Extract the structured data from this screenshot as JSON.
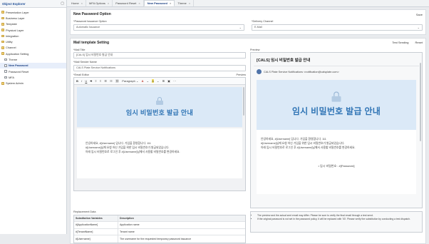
{
  "explorer": {
    "title": "Object Explorer",
    "items": [
      {
        "label": "Presentation Layer",
        "child": false,
        "selected": false
      },
      {
        "label": "Business Layer",
        "child": false,
        "selected": false
      },
      {
        "label": "Template",
        "child": false,
        "selected": false
      },
      {
        "label": "Physical Layer",
        "child": false,
        "selected": false
      },
      {
        "label": "Integration",
        "child": false,
        "selected": false
      },
      {
        "label": "Utility",
        "child": false,
        "selected": false
      },
      {
        "label": "Channel",
        "child": false,
        "selected": false
      },
      {
        "label": "Application Setting",
        "child": false,
        "selected": false
      },
      {
        "label": "Theme",
        "child": true,
        "selected": false
      },
      {
        "label": "New Password",
        "child": true,
        "selected": true
      },
      {
        "label": "Password Reset",
        "child": true,
        "selected": false
      },
      {
        "label": "MFA",
        "child": true,
        "selected": false
      },
      {
        "label": "System Admin",
        "child": false,
        "selected": false
      }
    ]
  },
  "tabs": [
    {
      "label": "Home",
      "active": false
    },
    {
      "label": "MFA Options",
      "active": false
    },
    {
      "label": "Password Reset",
      "active": false
    },
    {
      "label": "New Password",
      "active": true
    },
    {
      "label": "Theme",
      "active": false
    }
  ],
  "options": {
    "title": "New Password Option",
    "save_label": "Save",
    "issuance_label": "*Password Issuance Option",
    "issuance_value": "Automatic Issuance",
    "delivery_label": "*Delivery Channel",
    "delivery_value": "E-Mail"
  },
  "mail": {
    "title": "Mail template Setting",
    "test_label": "Test Sending",
    "reset_label": "Reset",
    "mail_title_label": "*Mail Title",
    "mail_title_value": "[CALS] 임시 비밀번호 발급 안내",
    "sender_label": "*Mail Sender Name",
    "sender_value": "CALS Plate Service Notifications",
    "editor_label": "*Email Editor",
    "preview_link": "Preview",
    "toolbar": {
      "bold": "B",
      "italic": "I",
      "underline": "U",
      "strike": "S",
      "paragraph": "Paragraph",
      "color": "A",
      "highlight": "A",
      "more": "⋯"
    },
    "banner_title": "임시 비밀번호 발급 안내",
    "body_lines": [
      "안녕하세요, #[Username] 입니다. 가입을 환영합니다. 111",
      "#[Username]님께 요청 하신 가입을 위한 임시 비밀번호가 발급되었습니다.",
      "아래 임시 비밀번호로 로그인 후 #[Username]님께서 사용할 비밀번호를 변경하세요."
    ]
  },
  "preview": {
    "label": "Preview",
    "subject": "[CALS] 임시 비밀번호 발급 안내",
    "sender": "CALS Plate Service Notifications <notification@calsplate.com>",
    "banner_title": "임시 비밀번호 발급 안내",
    "body_lines": [
      "안녕하세요, #[Username] 입니다. 가입을 환영합니다. 111",
      "#[Username]님께 요청 하신 가입을 위한 임시 비밀번호가 발급되었습니다.",
      "아래 임시 비밀번호로 로그인 후 #[Username]님께서 사용할 비밀번호를 변경하세요."
    ],
    "password_line": "• 임시 비밀번호 : #[Password]"
  },
  "replacement": {
    "title": "Replacement Data",
    "headers": [
      "Substitution Variables",
      "Description"
    ],
    "rows": [
      [
        "#[ApplicationName]",
        "Application name"
      ],
      [
        "#[TenantName]",
        "Tenant name"
      ],
      [
        "#[Username]",
        "The username for the requested temporary password issuance"
      ]
    ]
  },
  "notes": [
    "The preview and the actual sent email may differ. Please be sure to verify the final email through a test send.",
    "If the original password is not set in the password policy, it will be replaced with '00'. Please verify the substitution by conducting a test dispatch."
  ]
}
